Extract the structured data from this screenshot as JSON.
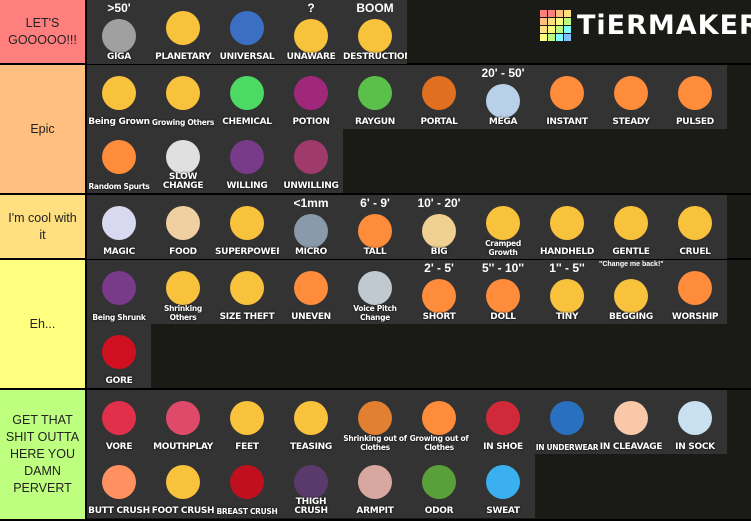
{
  "logo": {
    "text": "TiERMAKER",
    "grid_colors": [
      "#ff7f7f",
      "#ff7f7f",
      "#ffbf7f",
      "#ffdf7f",
      "#ffbf7f",
      "#ffdf7f",
      "#ffff7f",
      "#bfff7f",
      "#ffdf7f",
      "#ffff7f",
      "#bfff7f",
      "#7fffff",
      "#ffff7f",
      "#bfff7f",
      "#7fffff",
      "#7fbfff"
    ]
  },
  "tiers": [
    {
      "label": "LET'S GOOOOO!!!",
      "color": "#ff7f7f",
      "height": 63,
      "items": [
        {
          "name": "GIGA",
          "top": ">50'",
          "icon": "mountain-icon",
          "color": "#a0a0a0"
        },
        {
          "name": "PLANETARY",
          "icon": "blushing-face-planet-icon",
          "color": "#f9c23c"
        },
        {
          "name": "UNIVERSAL",
          "icon": "galaxy-icon",
          "color": "#3a6fc4"
        },
        {
          "name": "UNAWARE",
          "top": "?",
          "icon": "neutral-face-icon",
          "color": "#f9c23c"
        },
        {
          "name": "DESTRUCTION",
          "top": "BOOM",
          "icon": "face-city-icon",
          "color": "#f9c23c"
        }
      ]
    },
    {
      "label": "Epic",
      "color": "#ffbf7f",
      "height": 128,
      "items": [
        {
          "name": "Being Grown",
          "icon": "blushing-face-icon",
          "color": "#f9c23c"
        },
        {
          "name": "Growing Others",
          "icon": "blushing-face-icon",
          "color": "#f9c23c"
        },
        {
          "name": "CHEMICAL",
          "icon": "bottle-icon",
          "color": "#4cd964"
        },
        {
          "name": "POTION",
          "icon": "potion-icon",
          "color": "#a0287a"
        },
        {
          "name": "RAYGUN",
          "icon": "raygun-icon",
          "color": "#5ac04a"
        },
        {
          "name": "PORTAL",
          "icon": "portal-icon",
          "color": "#e07020"
        },
        {
          "name": "MEGA",
          "top": "20' - 50'",
          "icon": "building-icon",
          "color": "#b8d0e8"
        },
        {
          "name": "INSTANT",
          "icon": "step-icon",
          "color": "#ff8c3a"
        },
        {
          "name": "STEADY",
          "icon": "slope-icon",
          "color": "#ff8c3a"
        },
        {
          "name": "PULSED",
          "icon": "stairs-icon",
          "color": "#ff8c3a"
        },
        {
          "name": "Random Spurts",
          "icon": "random-stairs-icon",
          "color": "#ff8c3a"
        },
        {
          "name": "SLOW CHANGE",
          "icon": "stopwatch-icon",
          "color": "#e0e0e0"
        },
        {
          "name": "WILLING",
          "icon": "devil-face-icon",
          "color": "#7a3a8a"
        },
        {
          "name": "UNWILLING",
          "icon": "confounded-devil-icon",
          "color": "#a03a6a"
        }
      ]
    },
    {
      "label": "I'm cool with it",
      "color": "#ffdf7f",
      "height": 63,
      "items": [
        {
          "name": "MAGIC",
          "icon": "magic-book-icon",
          "color": "#d8d8f0"
        },
        {
          "name": "FOOD",
          "icon": "cake-icon",
          "color": "#f0d0a0"
        },
        {
          "name": "SUPERPOWER",
          "icon": "snap-hand-icon",
          "color": "#f9c23c"
        },
        {
          "name": "MICRO",
          "top": "<1mm",
          "icon": "microscope-icon",
          "color": "#8a9aaa"
        },
        {
          "name": "TALL",
          "top": "6' - 9'",
          "icon": "person-icon",
          "color": "#ff8c3a"
        },
        {
          "name": "BIG",
          "top": "10' - 20'",
          "icon": "house-icon",
          "color": "#f0d090"
        },
        {
          "name": "Cramped Growth",
          "icon": "face-in-house-icon",
          "color": "#f9c23c"
        },
        {
          "name": "HANDHELD",
          "icon": "hand-person-icon",
          "color": "#f9c23c"
        },
        {
          "name": "GENTLE",
          "icon": "kissing-faces-icon",
          "color": "#f9c23c"
        },
        {
          "name": "CRUEL",
          "icon": "crushing-face-icon",
          "color": "#f9c23c"
        }
      ]
    },
    {
      "label": "Eh...",
      "color": "#ffff7f",
      "height": 128,
      "items": [
        {
          "name": "Being Shrunk",
          "icon": "devil-face-icon",
          "color": "#7a3a8a"
        },
        {
          "name": "Shrinking Others",
          "icon": "smirk-face-icon",
          "color": "#f9c23c"
        },
        {
          "name": "SIZE THEFT",
          "icon": "blushing-face-icon",
          "color": "#f9c23c"
        },
        {
          "name": "UNEVEN",
          "icon": "person-icon",
          "color": "#ff8c3a"
        },
        {
          "name": "Voice Pitch Change",
          "icon": "mouse-megaphone-icon",
          "color": "#c0c8d0"
        },
        {
          "name": "SHORT",
          "top": "2' - 5'",
          "icon": "person-icon",
          "color": "#ff8c3a"
        },
        {
          "name": "DOLL",
          "top": "5'' - 10''",
          "icon": "tiny-person-icon",
          "color": "#ff8c3a"
        },
        {
          "name": "TINY",
          "top": "1'' - 5''",
          "icon": "pinch-hand-icon",
          "color": "#f9c23c"
        },
        {
          "name": "BEGGING",
          "top": "\"Change me back!\" \"Please!!\"",
          "icon": "pleading-face-icon",
          "color": "#f9c23c"
        },
        {
          "name": "WORSHIP",
          "icon": "kneeling-person-icon",
          "color": "#ff8c3a"
        },
        {
          "name": "GORE",
          "icon": "blood-drops-icon",
          "color": "#d01020"
        }
      ]
    },
    {
      "label": "GET THAT SHIT OUTTA HERE YOU DAMN PERVERT",
      "color": "#bfff7f",
      "height": 129,
      "items": [
        {
          "name": "VORE",
          "icon": "lips-icon",
          "color": "#e0304a"
        },
        {
          "name": "MOUTHPLAY",
          "icon": "tongue-icon",
          "color": "#e04a6a"
        },
        {
          "name": "FEET",
          "icon": "foot-icon",
          "color": "#f9c23c"
        },
        {
          "name": "TEASING",
          "icon": "grinning-face-icon",
          "color": "#f9c23c"
        },
        {
          "name": "Shrinking out of Clothes",
          "icon": "clothes-pile-icon",
          "color": "#e08030"
        },
        {
          "name": "Growing out of Clothes",
          "icon": "person-icon",
          "color": "#ff8c3a"
        },
        {
          "name": "IN SHOE",
          "icon": "sneaker-icon",
          "color": "#d02a3a"
        },
        {
          "name": "IN UNDERWEAR",
          "icon": "briefs-icon",
          "color": "#2a70c0"
        },
        {
          "name": "IN CLEAVAGE",
          "icon": "cleavage-icon",
          "color": "#f8c8a8"
        },
        {
          "name": "IN SOCK",
          "icon": "sock-icon",
          "color": "#c8e0f0"
        },
        {
          "name": "BUTT CRUSH",
          "icon": "peach-icon",
          "color": "#ff9060"
        },
        {
          "name": "FOOT CRUSH",
          "icon": "foot-icon",
          "color": "#f9c23c"
        },
        {
          "name": "BREAST CRUSH",
          "icon": "cherries-icon",
          "color": "#c01020"
        },
        {
          "name": "THIGH CRUSH",
          "icon": "thigh-icon",
          "color": "#5a3a6a"
        },
        {
          "name": "ARMPIT",
          "icon": "armpit-sparkle-icon",
          "color": "#d8a8a0"
        },
        {
          "name": "ODOR",
          "icon": "nauseated-face-icon",
          "color": "#5aa03a"
        },
        {
          "name": "SWEAT",
          "icon": "sweat-drops-icon",
          "color": "#3ab0f0"
        }
      ]
    }
  ]
}
